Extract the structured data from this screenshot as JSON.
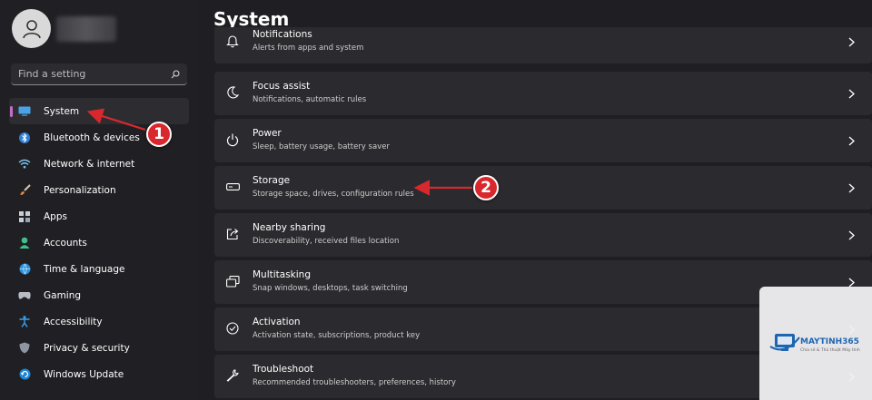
{
  "sidebar": {
    "search": {
      "placeholder": "Find a setting"
    },
    "items": [
      {
        "label": "System",
        "icon": "monitor-icon",
        "active": true
      },
      {
        "label": "Bluetooth & devices",
        "icon": "bluetooth-icon"
      },
      {
        "label": "Network & internet",
        "icon": "wifi-icon"
      },
      {
        "label": "Personalization",
        "icon": "brush-icon"
      },
      {
        "label": "Apps",
        "icon": "apps-icon"
      },
      {
        "label": "Accounts",
        "icon": "person-icon"
      },
      {
        "label": "Time & language",
        "icon": "globe-clock-icon"
      },
      {
        "label": "Gaming",
        "icon": "gamepad-icon"
      },
      {
        "label": "Accessibility",
        "icon": "accessibility-icon"
      },
      {
        "label": "Privacy & security",
        "icon": "shield-icon"
      },
      {
        "label": "Windows Update",
        "icon": "update-icon"
      }
    ]
  },
  "main": {
    "title": "System",
    "cards": [
      {
        "title": "Notifications",
        "subtitle": "Alerts from apps and system",
        "icon": "bell-icon"
      },
      {
        "title": "Focus assist",
        "subtitle": "Notifications, automatic rules",
        "icon": "moon-icon"
      },
      {
        "title": "Power",
        "subtitle": "Sleep, battery usage, battery saver",
        "icon": "power-icon"
      },
      {
        "title": "Storage",
        "subtitle": "Storage space, drives, configuration rules",
        "icon": "storage-icon"
      },
      {
        "title": "Nearby sharing",
        "subtitle": "Discoverability, received files location",
        "icon": "share-icon"
      },
      {
        "title": "Multitasking",
        "subtitle": "Snap windows, desktops, task switching",
        "icon": "multitask-icon"
      },
      {
        "title": "Activation",
        "subtitle": "Activation state, subscriptions, product key",
        "icon": "check-circle-icon"
      },
      {
        "title": "Troubleshoot",
        "subtitle": "Recommended troubleshooters, preferences, history",
        "icon": "wrench-icon"
      }
    ]
  },
  "annotations": [
    {
      "number": "1"
    },
    {
      "number": "2"
    }
  ],
  "watermark": {
    "brand": "MAYTINH365",
    "tagline": "Chia sẻ & Thủ thuật Máy tính"
  },
  "colors": {
    "accent": "#c86cc8",
    "annotation": "#d9282d",
    "background": "#1f1f23",
    "card": "#2b2b2f"
  }
}
